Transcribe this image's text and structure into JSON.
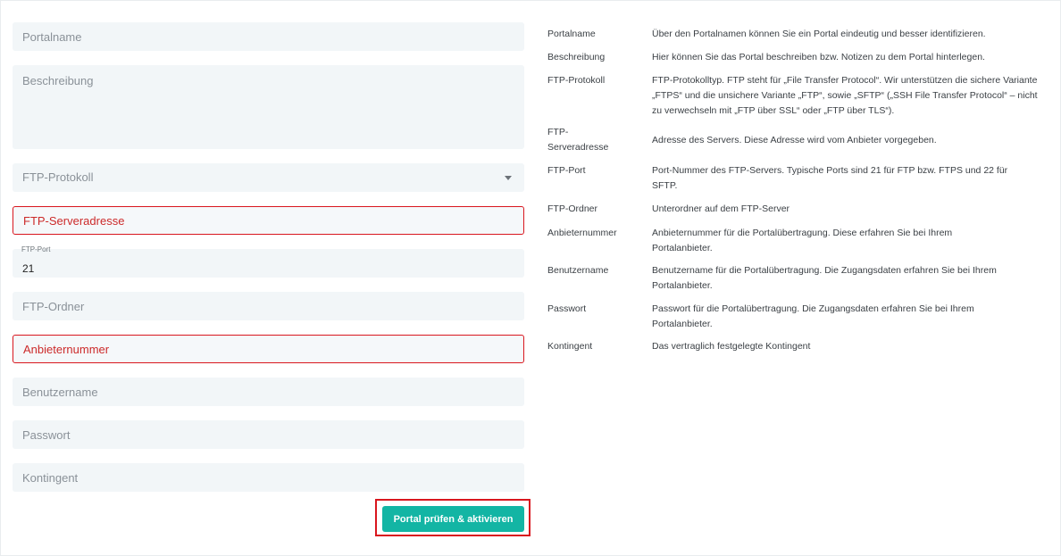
{
  "form": {
    "portalname_placeholder": "Portalname",
    "beschreibung_placeholder": "Beschreibung",
    "protokoll_placeholder": "FTP-Protokoll",
    "serveradresse_placeholder": "FTP-Serveradresse",
    "port_label": "FTP-Port",
    "port_value": "21",
    "ordner_placeholder": "FTP-Ordner",
    "anbieternummer_placeholder": "Anbieternummer",
    "benutzername_placeholder": "Benutzername",
    "passwort_placeholder": "Passwort",
    "kontingent_placeholder": "Kontingent",
    "submit_label": "Portal prüfen & aktivieren"
  },
  "help": [
    {
      "term": "Portalname",
      "desc": "Über den Portalnamen können Sie ein Portal eindeutig und besser identifizieren."
    },
    {
      "term": "Beschreibung",
      "desc": "Hier können Sie das Portal beschreiben bzw. Notizen zu dem Portal hinterlegen."
    },
    {
      "term": "FTP-Protokoll",
      "desc": "FTP-Protokolltyp. FTP steht für „File Transfer Protocol“. Wir unterstützen die sichere Variante „FTPS“ und die unsichere Variante „FTP“, sowie „SFTP“ („SSH File Transfer Protocol“ – nicht zu verwechseln mit „FTP über SSL“ oder „FTP über TLS“)."
    },
    {
      "term": "FTP-Serveradresse",
      "desc": "Adresse des Servers. Diese Adresse wird vom Anbieter vorgegeben."
    },
    {
      "term": "FTP-Port",
      "desc": "Port-Nummer des FTP-Servers. Typische Ports sind 21 für FTP bzw. FTPS und 22 für SFTP."
    },
    {
      "term": "FTP-Ordner",
      "desc": "Unterordner auf dem FTP-Server"
    },
    {
      "term": "Anbieternummer",
      "desc": "Anbieternummer für die Portalübertragung. Diese erfahren Sie bei Ihrem Portalanbieter."
    },
    {
      "term": "Benutzername",
      "desc": "Benutzername für die Portalübertragung. Die Zugangsdaten erfahren Sie bei Ihrem Portalanbieter."
    },
    {
      "term": "Passwort",
      "desc": "Passwort für die Portalübertragung. Die Zugangsdaten erfahren Sie bei Ihrem Portalanbieter."
    },
    {
      "term": "Kontingent",
      "desc": "Das vertraglich festgelegte Kontingent"
    }
  ]
}
